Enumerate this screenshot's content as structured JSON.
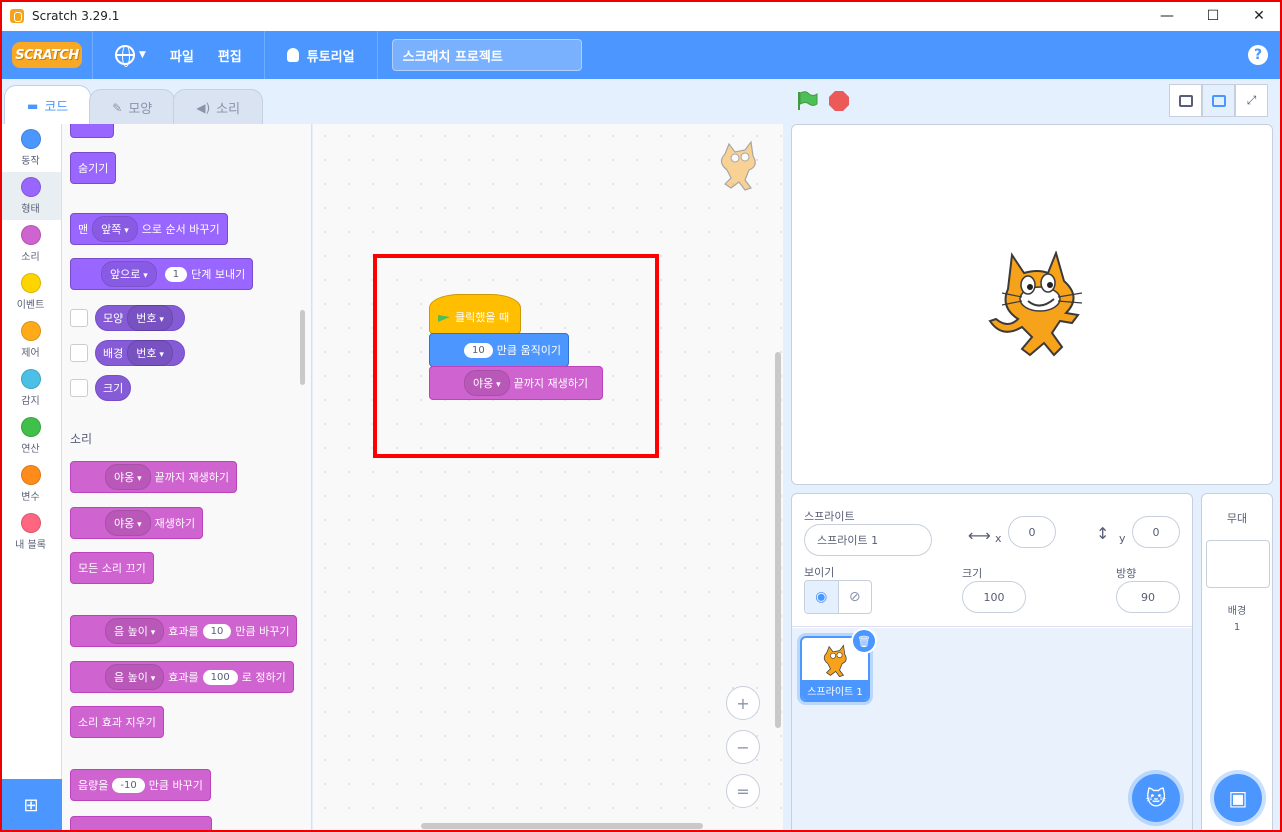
{
  "window": {
    "title": "Scratch 3.29.1",
    "minimize": "—",
    "maximize": "☐",
    "close": "✕"
  },
  "menubar": {
    "logo": "SCRATCH",
    "file": "파일",
    "edit": "편집",
    "tutorials": "튜토리얼",
    "project_name": "스크래치 프로젝트",
    "help": "?"
  },
  "tabs": {
    "code": "코드",
    "costumes": "모양",
    "sounds": "소리"
  },
  "categories": [
    {
      "label": "동작",
      "color": "#4c97ff"
    },
    {
      "label": "형태",
      "color": "#9966ff"
    },
    {
      "label": "소리",
      "color": "#cf63cf"
    },
    {
      "label": "이벤트",
      "color": "#ffd500"
    },
    {
      "label": "제어",
      "color": "#ffab19"
    },
    {
      "label": "감지",
      "color": "#4cbfe6"
    },
    {
      "label": "연산",
      "color": "#40bf4a"
    },
    {
      "label": "변수",
      "color": "#ff8c1a"
    },
    {
      "label": "내 블록",
      "color": "#ff6680"
    }
  ],
  "palette": {
    "hide": "숨기기",
    "goto_layer": {
      "prefix": "맨",
      "option": "앞쪽",
      "suffix": "으로 순서 바꾸기"
    },
    "go_layers": {
      "option": "앞으로",
      "value": "1",
      "suffix": "단계 보내기"
    },
    "costume_reporter": {
      "label": "모양",
      "option": "번호"
    },
    "backdrop_reporter": {
      "label": "배경",
      "option": "번호"
    },
    "size_reporter": "크기",
    "sound_heading": "소리",
    "play_until_done": {
      "option": "야옹",
      "suffix": "끝까지 재생하기"
    },
    "play": {
      "option": "야옹",
      "suffix": "재생하기"
    },
    "stop_all": "모든 소리 끄기",
    "change_effect": {
      "option": "음 높이",
      "mid": "효과를",
      "value": "10",
      "suffix": "만큼 바꾸기"
    },
    "set_effect": {
      "option": "음 높이",
      "mid": "효과를",
      "value": "100",
      "suffix": "로 정하기"
    },
    "clear_effects": "소리 효과 지우기",
    "change_volume": {
      "prefix": "음량을",
      "value": "-10",
      "suffix": "만큼 바꾸기"
    }
  },
  "script": {
    "hat": "클릭했을 때",
    "move": {
      "value": "10",
      "suffix": "만큼 움직이기"
    },
    "sound": {
      "option": "야옹",
      "suffix": "끝까지 재생하기"
    }
  },
  "zoom": {
    "in": "+",
    "out": "−",
    "reset": "="
  },
  "sprite_info": {
    "sprite_label": "스프라이트",
    "sprite_name": "스프라이트 1",
    "x_label": "x",
    "x_value": "0",
    "y_label": "y",
    "y_value": "0",
    "show_label": "보이기",
    "size_label": "크기",
    "size_value": "100",
    "direction_label": "방향",
    "direction_value": "90"
  },
  "sprite_list": [
    {
      "name": "스프라이트 1"
    }
  ],
  "stage_pane": {
    "title": "무대",
    "backdrops_label": "배경",
    "backdrops_count": "1"
  },
  "colors": {
    "accent": "#4c97ff",
    "highlight": "#ff0000",
    "events": "#ffbf00",
    "looks": "#9966ff",
    "sound": "#cf63cf",
    "motion": "#4c97ff"
  }
}
